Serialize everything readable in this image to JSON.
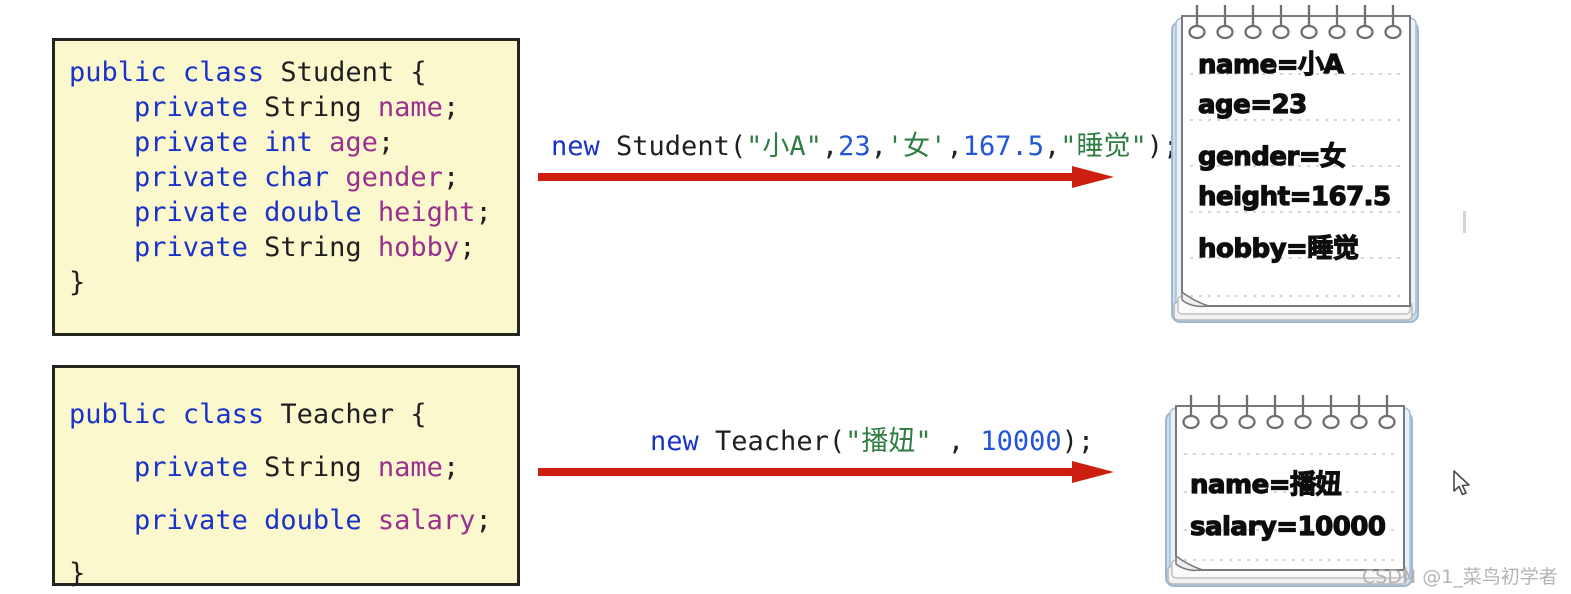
{
  "background_color": "#ffffff",
  "colors": {
    "code_bg": "#fbf8cd",
    "code_border": "#25251f",
    "keyword": "#1b32c8",
    "plain": "#1f1f1f",
    "field": "#9b2f8e",
    "string": "#2f7d43",
    "number": "#2256d8",
    "arrow_red": "#cc1f10",
    "notepad_board": "#c9def2",
    "notepad_paper": "#ffffff",
    "rule_line": "#c9c9c9",
    "watermark": "#b4b4b4"
  },
  "code_blocks": [
    {
      "name": "student-class",
      "lines": [
        [
          {
            "text": "public",
            "style": "k"
          },
          {
            "text": " ",
            "style": "t"
          },
          {
            "text": "class",
            "style": "k"
          },
          {
            "text": " ",
            "style": "t"
          },
          {
            "text": "Student",
            "style": "t"
          },
          {
            "text": " {",
            "style": "t"
          }
        ],
        [
          {
            "text": "    ",
            "style": "t"
          },
          {
            "text": "private",
            "style": "k"
          },
          {
            "text": " ",
            "style": "t"
          },
          {
            "text": "String",
            "style": "t"
          },
          {
            "text": " ",
            "style": "t"
          },
          {
            "text": "name",
            "style": "f"
          },
          {
            "text": ";",
            "style": "t"
          }
        ],
        [
          {
            "text": "    ",
            "style": "t"
          },
          {
            "text": "private",
            "style": "k"
          },
          {
            "text": " ",
            "style": "t"
          },
          {
            "text": "int",
            "style": "k"
          },
          {
            "text": " ",
            "style": "t"
          },
          {
            "text": "age",
            "style": "f"
          },
          {
            "text": ";",
            "style": "t"
          }
        ],
        [
          {
            "text": "    ",
            "style": "t"
          },
          {
            "text": "private",
            "style": "k"
          },
          {
            "text": " ",
            "style": "t"
          },
          {
            "text": "char",
            "style": "k"
          },
          {
            "text": " ",
            "style": "t"
          },
          {
            "text": "gender",
            "style": "f"
          },
          {
            "text": ";",
            "style": "t"
          }
        ],
        [
          {
            "text": "    ",
            "style": "t"
          },
          {
            "text": "private",
            "style": "k"
          },
          {
            "text": " ",
            "style": "t"
          },
          {
            "text": "double",
            "style": "k"
          },
          {
            "text": " ",
            "style": "t"
          },
          {
            "text": "height",
            "style": "f"
          },
          {
            "text": ";",
            "style": "t"
          }
        ],
        [
          {
            "text": "    ",
            "style": "t"
          },
          {
            "text": "private",
            "style": "k"
          },
          {
            "text": " ",
            "style": "t"
          },
          {
            "text": "String",
            "style": "t"
          },
          {
            "text": " ",
            "style": "t"
          },
          {
            "text": "hobby",
            "style": "f"
          },
          {
            "text": ";",
            "style": "t"
          }
        ],
        [
          {
            "text": "}",
            "style": "t"
          }
        ]
      ]
    },
    {
      "name": "teacher-class",
      "lines": [
        [
          {
            "text": "public",
            "style": "k"
          },
          {
            "text": " ",
            "style": "t"
          },
          {
            "text": "class",
            "style": "k"
          },
          {
            "text": " ",
            "style": "t"
          },
          {
            "text": "Teacher",
            "style": "t"
          },
          {
            "text": " {",
            "style": "t"
          }
        ],
        [
          {
            "text": "    ",
            "style": "t"
          },
          {
            "text": "private",
            "style": "k"
          },
          {
            "text": " ",
            "style": "t"
          },
          {
            "text": "String",
            "style": "t"
          },
          {
            "text": " ",
            "style": "t"
          },
          {
            "text": "name",
            "style": "f"
          },
          {
            "text": ";",
            "style": "t"
          }
        ],
        [
          {
            "text": "    ",
            "style": "t"
          },
          {
            "text": "private",
            "style": "k"
          },
          {
            "text": " ",
            "style": "t"
          },
          {
            "text": "double",
            "style": "k"
          },
          {
            "text": " ",
            "style": "t"
          },
          {
            "text": "salary",
            "style": "f"
          },
          {
            "text": ";",
            "style": "t"
          }
        ],
        [
          {
            "text": "}",
            "style": "t"
          }
        ]
      ]
    }
  ],
  "expressions": [
    {
      "name": "student-constructor-call",
      "plain_text": "new Student(\"小A\",23,'女',167.5,\"睡觉\");",
      "tokens": [
        {
          "text": "new",
          "style": "k"
        },
        {
          "text": " Student(",
          "style": "t"
        },
        {
          "text": "\"小A\"",
          "style": "s"
        },
        {
          "text": ",",
          "style": "t"
        },
        {
          "text": "23",
          "style": "n"
        },
        {
          "text": ",",
          "style": "t"
        },
        {
          "text": "'女'",
          "style": "s"
        },
        {
          "text": ",",
          "style": "t"
        },
        {
          "text": "167.5",
          "style": "n"
        },
        {
          "text": ",",
          "style": "t"
        },
        {
          "text": "\"睡觉\"",
          "style": "s"
        },
        {
          "text": ");",
          "style": "t"
        }
      ]
    },
    {
      "name": "teacher-constructor-call",
      "plain_text": "new Teacher(\"播妞\" , 10000);",
      "tokens": [
        {
          "text": "new",
          "style": "k"
        },
        {
          "text": " Teacher(",
          "style": "t"
        },
        {
          "text": "\"播妞\"",
          "style": "s"
        },
        {
          "text": " , ",
          "style": "t"
        },
        {
          "text": "10000",
          "style": "n"
        },
        {
          "text": ");",
          "style": "t"
        }
      ]
    }
  ],
  "notepads": [
    {
      "name": "student-object-notepad",
      "rings": 8,
      "rows": [
        {
          "label": "name",
          "value": "小A",
          "text": "name=小A"
        },
        {
          "label": "age",
          "value": "23",
          "text": "age=23"
        },
        {
          "label": "gender",
          "value": "女",
          "text": "gender=女"
        },
        {
          "label": "height",
          "value": "167.5",
          "text": "height=167.5"
        },
        {
          "label": "hobby",
          "value": "睡觉",
          "text": "hobby=睡觉"
        }
      ]
    },
    {
      "name": "teacher-object-notepad",
      "rings": 8,
      "rows": [
        {
          "label": "name",
          "value": "播妞",
          "text": "name=播妞"
        },
        {
          "label": "salary",
          "value": "10000",
          "text": "salary=10000"
        }
      ]
    }
  ],
  "arrows": [
    {
      "name": "student-arrow",
      "direction": "right",
      "color": "#cc1f10"
    },
    {
      "name": "teacher-arrow",
      "direction": "right",
      "color": "#cc1f10"
    }
  ],
  "watermark": {
    "text": "CSDN @1_菜鸟初学者"
  }
}
